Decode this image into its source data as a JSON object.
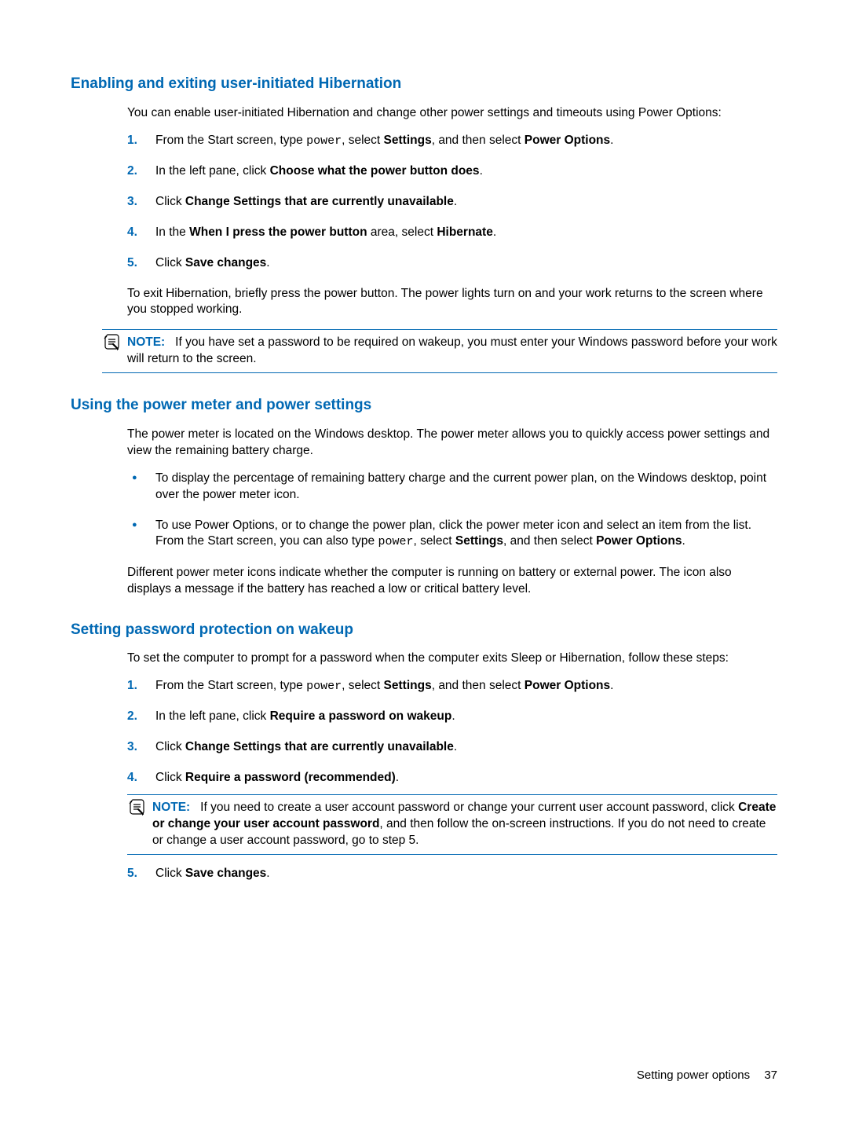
{
  "section1": {
    "title": "Enabling and exiting user-initiated Hibernation",
    "intro": "You can enable user-initiated Hibernation and change other power settings and timeouts using Power Options:",
    "step1_a": "From the Start screen, type ",
    "step1_code": "power",
    "step1_b": ", select ",
    "step1_bold1": "Settings",
    "step1_c": ", and then select ",
    "step1_bold2": "Power Options",
    "step1_d": ".",
    "step2_a": "In the left pane, click ",
    "step2_bold": "Choose what the power button does",
    "step2_b": ".",
    "step3_a": "Click ",
    "step3_bold": "Change Settings that are currently unavailable",
    "step3_b": ".",
    "step4_a": "In the ",
    "step4_bold1": "When I press the power button",
    "step4_b": " area, select ",
    "step4_bold2": "Hibernate",
    "step4_c": ".",
    "step5_a": "Click ",
    "step5_bold": "Save changes",
    "step5_b": ".",
    "after": "To exit Hibernation, briefly press the power button. The power lights turn on and your work returns to the screen where you stopped working.",
    "note_label": "NOTE:",
    "note_body": "If you have set a password to be required on wakeup, you must enter your Windows password before your work will return to the screen."
  },
  "numbers": {
    "n1": "1.",
    "n2": "2.",
    "n3": "3.",
    "n4": "4.",
    "n5": "5."
  },
  "section2": {
    "title": "Using the power meter and power settings",
    "intro": "The power meter is located on the Windows desktop. The power meter allows you to quickly access power settings and view the remaining battery charge.",
    "bullet1": "To display the percentage of remaining battery charge and the current power plan, on the Windows desktop, point over the power meter icon.",
    "bullet2_a": "To use Power Options, or to change the power plan, click the power meter icon and select an item from the list. From the Start screen, you can also type ",
    "bullet2_code": "power",
    "bullet2_b": ", select ",
    "bullet2_bold1": "Settings",
    "bullet2_c": ", and then select ",
    "bullet2_bold2": "Power Options",
    "bullet2_d": ".",
    "after": "Different power meter icons indicate whether the computer is running on battery or external power. The icon also displays a message if the battery has reached a low or critical battery level."
  },
  "section3": {
    "title": "Setting password protection on wakeup",
    "intro": "To set the computer to prompt for a password when the computer exits Sleep or Hibernation, follow these steps:",
    "step1_a": "From the Start screen, type ",
    "step1_code": "power",
    "step1_b": ", select ",
    "step1_bold1": "Settings",
    "step1_c": ", and then select ",
    "step1_bold2": "Power Options",
    "step1_d": ".",
    "step2_a": "In the left pane, click ",
    "step2_bold": "Require a password on wakeup",
    "step2_b": ".",
    "step3_a": "Click ",
    "step3_bold": "Change Settings that are currently unavailable",
    "step3_b": ".",
    "step4_a": "Click ",
    "step4_bold": "Require a password (recommended)",
    "step4_b": ".",
    "note_label": "NOTE:",
    "note_a": "If you need to create a user account password or change your current user account password, click ",
    "note_bold": "Create or change your user account password",
    "note_b": ", and then follow the on-screen instructions. If you do not need to create or change a user account password, go to step 5.",
    "step5_a": "Click ",
    "step5_bold": "Save changes",
    "step5_b": "."
  },
  "footer": {
    "text": "Setting power options",
    "page": "37"
  }
}
